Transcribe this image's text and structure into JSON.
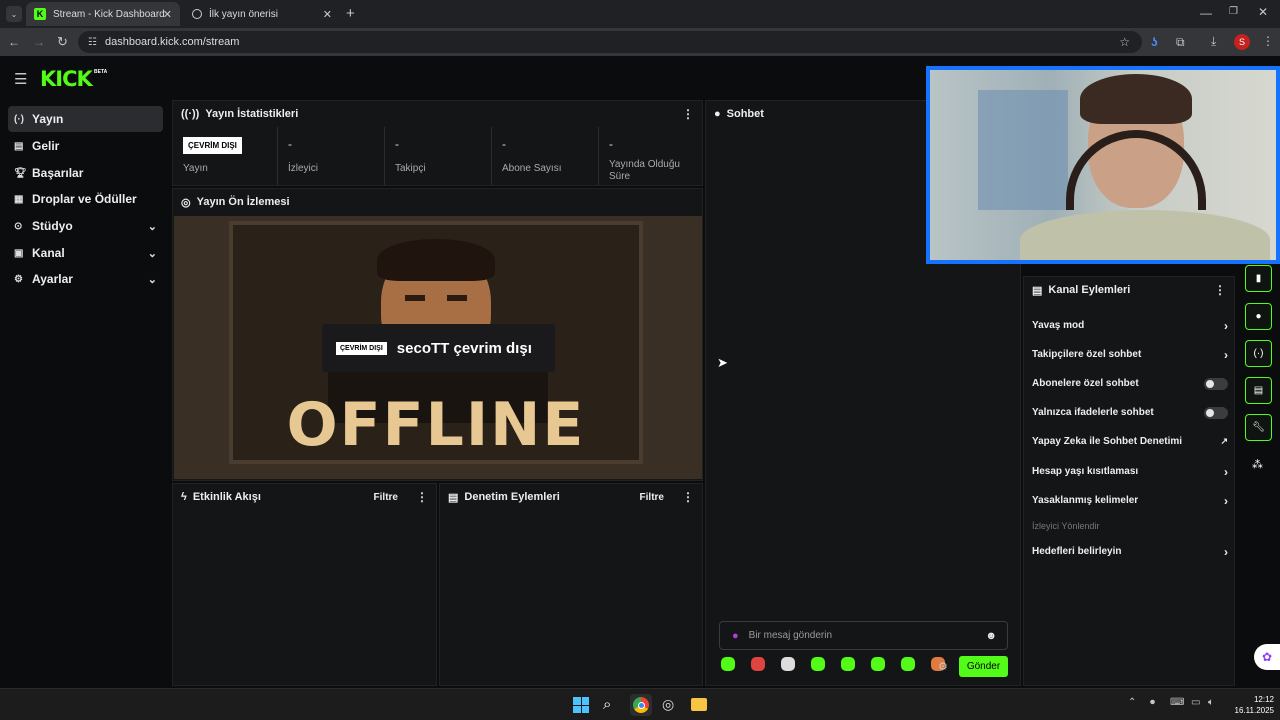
{
  "browser": {
    "tabs": [
      {
        "label": "Stream - Kick Dashboard",
        "icon": "kick-favicon"
      },
      {
        "label": "İlk yayın önerisi",
        "icon": "chatgpt-favicon"
      }
    ],
    "url": "dashboard.kick.com/stream",
    "profile_initial": "S"
  },
  "brand": {
    "logo": "KICK",
    "beta": "BETA",
    "accent": "#53fc18"
  },
  "sidebar": {
    "items": [
      {
        "label": "Yayın",
        "icon": "broadcast-icon"
      },
      {
        "label": "Gelir",
        "icon": "revenue-icon"
      },
      {
        "label": "Başarılar",
        "icon": "trophy-icon"
      },
      {
        "label": "Droplar ve Ödüller",
        "icon": "gift-icon"
      },
      {
        "label": "Stüdyo",
        "icon": "studio-icon"
      },
      {
        "label": "Kanal",
        "icon": "channel-icon"
      },
      {
        "label": "Ayarlar",
        "icon": "gear-icon"
      }
    ]
  },
  "stats": {
    "title": "Yayın İstatistikleri",
    "status_badge": "ÇEVRİM DIŞI",
    "cells": [
      {
        "value": "",
        "label": "Yayın"
      },
      {
        "value": "-",
        "label": "İzleyici"
      },
      {
        "value": "-",
        "label": "Takipçi"
      },
      {
        "value": "-",
        "label": "Abone Sayısı"
      },
      {
        "value": "-",
        "label": "Yayında Olduğu Süre"
      }
    ]
  },
  "preview": {
    "title": "Yayın Ön İzlemesi",
    "badge": "ÇEVRİM DIŞI",
    "message": "secoTT çevrim dışı",
    "offline_art": "OFFLINE"
  },
  "activity": {
    "title": "Etkinlik Akışı",
    "filter": "Filtre"
  },
  "moderation": {
    "title": "Denetim Eylemleri",
    "filter": "Filtre"
  },
  "chat": {
    "title": "Sohbet",
    "placeholder": "Bir mesaj gönderin",
    "send": "Gönder"
  },
  "channel_actions": {
    "title": "Kanal Eylemleri",
    "rows": [
      {
        "label": "Yavaş mod",
        "control": "chevron"
      },
      {
        "label": "Takipçilere özel sohbet",
        "control": "chevron"
      },
      {
        "label": "Abonelere özel sohbet",
        "control": "toggle"
      },
      {
        "label": "Yalnızca ifadelerle sohbet",
        "control": "toggle"
      },
      {
        "label": "Yapay Zeka ile Sohbet Denetimi",
        "control": "external"
      },
      {
        "label": "Hesap yaşı kısıtlaması",
        "control": "chevron"
      },
      {
        "label": "Yasaklanmış kelimeler",
        "control": "chevron"
      }
    ],
    "section_label": "İzleyici Yönlendir",
    "goal_row": "Hedefleri belirleyin"
  },
  "taskbar": {
    "time": "12:12",
    "date": "16.11.2025"
  }
}
